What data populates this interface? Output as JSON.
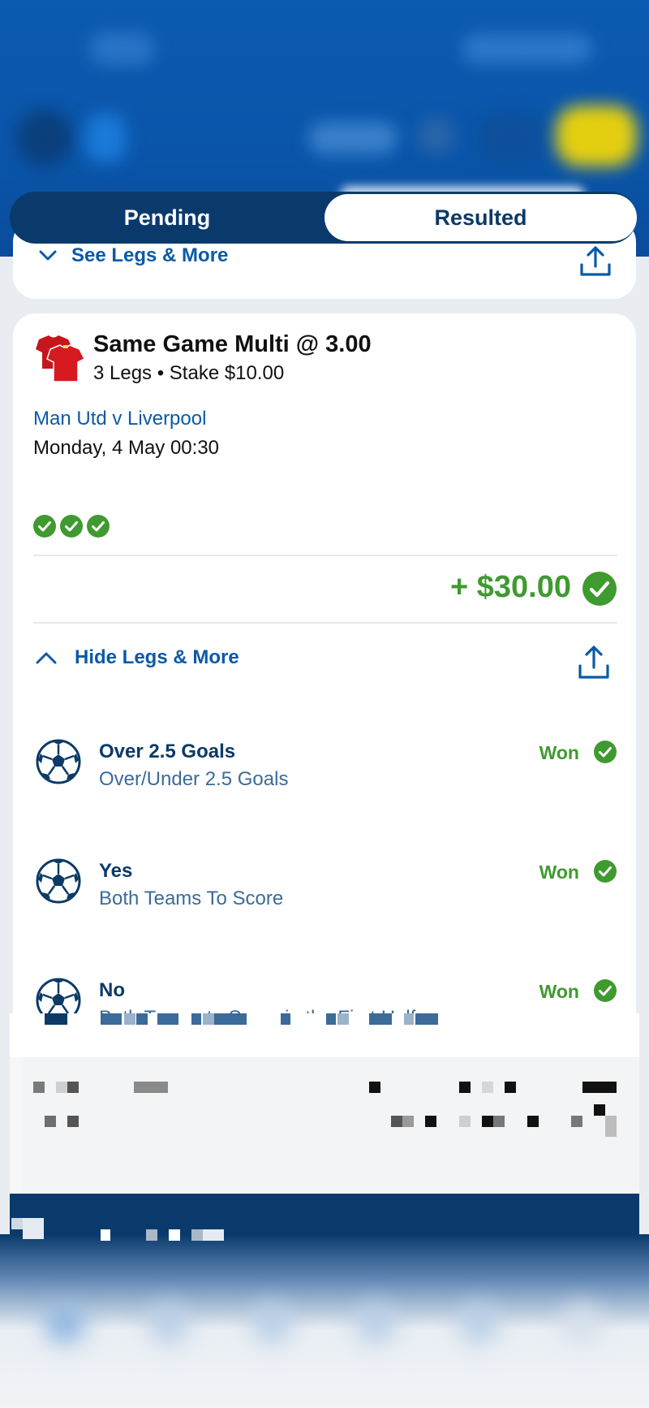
{
  "header": {
    "tabs": [
      {
        "label": "Pending",
        "active": false
      },
      {
        "label": "Resulted",
        "active": true
      }
    ]
  },
  "previous_card": {
    "toggle_label": "See Legs & More"
  },
  "bet_card": {
    "title": "Same Game Multi @ 3.00",
    "subtitle": "3 Legs • Stake $10.00",
    "match": "Man Utd v Liverpool",
    "date": "Monday, 4 May 00:30",
    "legs_won": 3,
    "payout": "+ $30.00",
    "toggle_label": "Hide Legs & More",
    "legs": [
      {
        "selection": "Over 2.5 Goals",
        "market": "Over/Under 2.5 Goals",
        "result": "Won"
      },
      {
        "selection": "Yes",
        "market": "Both Teams To Score",
        "result": "Won"
      },
      {
        "selection": "No",
        "market": "Both Teams to Score in the First Half",
        "result": "Won"
      }
    ]
  },
  "colors": {
    "brand_blue": "#0a5aa8",
    "navy": "#0b3a66",
    "won_green": "#3f9a2f",
    "header_blue": "#0b5bb2"
  }
}
